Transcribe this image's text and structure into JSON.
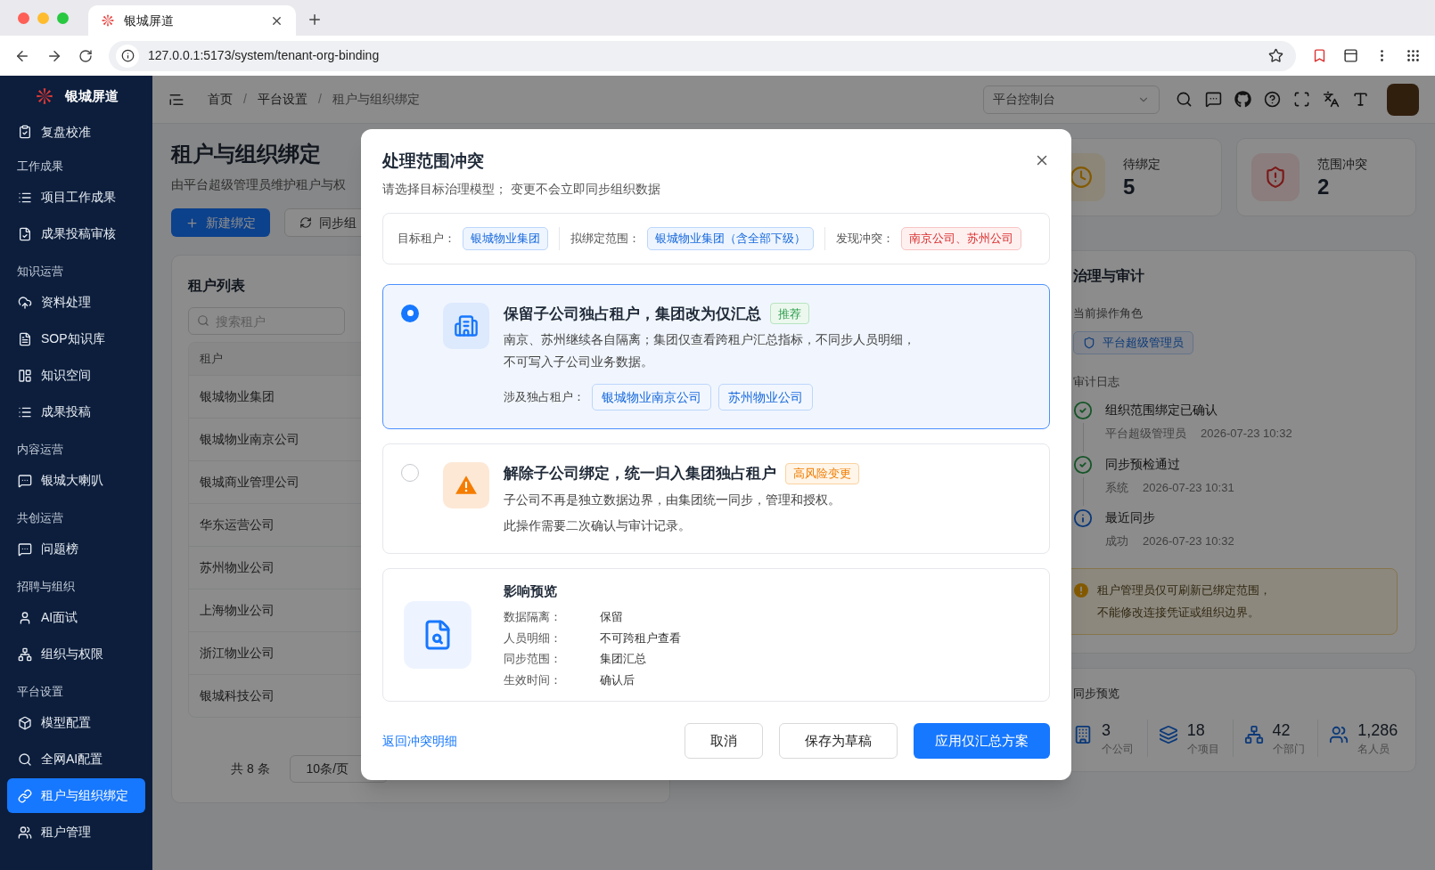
{
  "browser": {
    "tab_title": "银城屏道",
    "url": "127.0.0.1:5173/system/tenant-org-binding"
  },
  "sidebar": {
    "brand": "银城屏道",
    "items": [
      {
        "kind": "item",
        "label": "复盘校准",
        "selected": false
      },
      {
        "kind": "group",
        "label": "工作成果"
      },
      {
        "kind": "item",
        "label": "项目工作成果",
        "selected": false
      },
      {
        "kind": "item",
        "label": "成果投稿审核",
        "selected": false
      },
      {
        "kind": "group",
        "label": "知识运营"
      },
      {
        "kind": "item",
        "label": "资料处理",
        "selected": false
      },
      {
        "kind": "item",
        "label": "SOP知识库",
        "selected": false
      },
      {
        "kind": "item",
        "label": "知识空间",
        "selected": false
      },
      {
        "kind": "item",
        "label": "成果投稿",
        "selected": false
      },
      {
        "kind": "group",
        "label": "内容运营"
      },
      {
        "kind": "item",
        "label": "银城大喇叭",
        "selected": false
      },
      {
        "kind": "group",
        "label": "共创运营"
      },
      {
        "kind": "item",
        "label": "问题榜",
        "selected": false
      },
      {
        "kind": "group",
        "label": "招聘与组织"
      },
      {
        "kind": "item",
        "label": "AI面试",
        "selected": false
      },
      {
        "kind": "item",
        "label": "组织与权限",
        "selected": false
      },
      {
        "kind": "group",
        "label": "平台设置"
      },
      {
        "kind": "item",
        "label": "模型配置",
        "selected": false
      },
      {
        "kind": "item",
        "label": "全网AI配置",
        "selected": false
      },
      {
        "kind": "item",
        "label": "租户与组织绑定",
        "selected": true
      },
      {
        "kind": "item",
        "label": "租户管理",
        "selected": false
      }
    ]
  },
  "header": {
    "breadcrumb": [
      "首页",
      "平台设置",
      "租户与组织绑定"
    ],
    "separator": "/",
    "console_select": "平台控制台"
  },
  "page": {
    "title": "租户与组织绑定",
    "subtitle": "由平台超级管理员维护租户与权",
    "actions": [
      {
        "label": "新建绑定",
        "kind": "primary"
      },
      {
        "label": "同步组",
        "kind": "secondary"
      }
    ]
  },
  "tenant_list": {
    "title": "租户列表",
    "search_placeholder": "搜索租户",
    "column_1": "租户",
    "rows": [
      "银城物业集团",
      "银城物业南京公司",
      "银城商业管理公司",
      "华东运营公司",
      "苏州物业公司",
      "上海物业公司",
      "浙江物业公司",
      "银城科技公司"
    ],
    "total": "共 8 条",
    "page_size": "10条/页"
  },
  "stats": [
    {
      "label": "待绑定",
      "value": "5",
      "kind": "pending"
    },
    {
      "label": "范围冲突",
      "value": "2",
      "kind": "conflict"
    }
  ],
  "governance": {
    "title": "治理与审计",
    "role_label": "当前操作角色",
    "role": "平台超级管理员",
    "log_title": "审计日志",
    "log": [
      {
        "title": "组织范围绑定已确认",
        "actor": "平台超级管理员",
        "time": "2026-07-23 10:32",
        "kind": "success"
      },
      {
        "title": "同步预检通过",
        "actor": "系统",
        "time": "2026-07-23 10:31",
        "kind": "success"
      },
      {
        "title": "最近同步",
        "actor": "成功",
        "time": "2026-07-23 10:32",
        "kind": "info"
      }
    ],
    "notice": [
      "租户管理员仅可刷新已绑定范围，",
      "不能修改连接凭证或组织边界。"
    ]
  },
  "sync_preview": {
    "title": "同步预览",
    "items": [
      {
        "value": "3",
        "unit": "个公司"
      },
      {
        "value": "18",
        "unit": "个项目"
      },
      {
        "value": "42",
        "unit": "个部门"
      },
      {
        "value": "1,286",
        "unit": "名人员"
      }
    ]
  },
  "modal": {
    "title": "处理范围冲突",
    "subtitle": "请选择目标治理模型； 变更不会立即同步组织数据",
    "summary": [
      {
        "label": "目标租户：",
        "value": "银城物业集团",
        "kind": "info"
      },
      {
        "label": "拟绑定范围：",
        "value": "银城物业集团（含全部下级）",
        "kind": "info"
      },
      {
        "label": "发现冲突：",
        "value": "南京公司、苏州公司",
        "kind": "danger"
      }
    ],
    "options": [
      {
        "kind": "building",
        "selected": true,
        "title": "保留子公司独占租户，集团改为仅汇总",
        "badge": {
          "text": "推荐",
          "kind": "recommended"
        },
        "lines": [
          "南京、苏州继续各自隔离；集团仅查看跨租户汇总指标，不同步人员明细，",
          "不可写入子公司业务数据。"
        ],
        "tenants_label": "涉及独占租户：",
        "tenants": [
          "银城物业南京公司",
          "苏州物业公司"
        ]
      },
      {
        "kind": "warning",
        "selected": false,
        "title": "解除子公司绑定，统一归入集团独占租户",
        "badge": {
          "text": "高风险变更",
          "kind": "risk"
        },
        "lines": [
          "子公司不再是独立数据边界，由集团统一同步，管理和授权。",
          "此操作需要二次确认与审计记录。"
        ]
      }
    ],
    "preview": {
      "title": "影响预览",
      "rows": [
        {
          "label": "数据隔离：",
          "value": "保留"
        },
        {
          "label": "人员明细：",
          "value": "不可跨租户查看"
        },
        {
          "label": "同步范围：",
          "value": "集团汇总"
        },
        {
          "label": "生效时间：",
          "value": "确认后"
        }
      ]
    },
    "back_link": "返回冲突明细",
    "buttons": [
      {
        "label": "取消",
        "kind": "default"
      },
      {
        "label": "保存为草稿",
        "kind": "default"
      },
      {
        "label": "应用仅汇总方案",
        "kind": "primary"
      }
    ]
  }
}
